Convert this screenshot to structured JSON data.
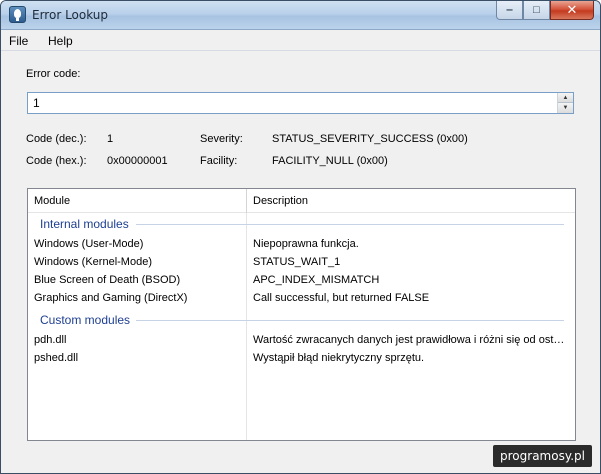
{
  "window": {
    "title": "Error Lookup"
  },
  "menu": [
    {
      "label": "File"
    },
    {
      "label": "Help"
    }
  ],
  "error_code": {
    "label": "Error code:",
    "value": "1"
  },
  "info": {
    "code_dec_label": "Code (dec.):",
    "code_dec_value": "1",
    "code_hex_label": "Code (hex.):",
    "code_hex_value": "0x00000001",
    "severity_label": "Severity:",
    "severity_value": "STATUS_SEVERITY_SUCCESS (0x00)",
    "facility_label": "Facility:",
    "facility_value": "FACILITY_NULL (0x00)"
  },
  "list": {
    "columns": [
      "Module",
      "Description"
    ],
    "groups": [
      {
        "name": "Internal modules",
        "rows": [
          {
            "module": "Windows (User-Mode)",
            "description": "Niepoprawna funkcja."
          },
          {
            "module": "Windows (Kernel-Mode)",
            "description": "STATUS_WAIT_1"
          },
          {
            "module": "Blue Screen of Death (BSOD)",
            "description": "APC_INDEX_MISMATCH"
          },
          {
            "module": "Graphics and Gaming (DirectX)",
            "description": "Call successful, but returned FALSE"
          }
        ]
      },
      {
        "name": "Custom modules",
        "rows": [
          {
            "module": "pdh.dll",
            "description": "Wartość zwracanych danych jest prawidłowa i różni się od ost…"
          },
          {
            "module": "pshed.dll",
            "description": "Wystąpił błąd niekrytyczny sprzętu."
          }
        ]
      }
    ]
  },
  "watermark": {
    "text": "programosy.pl"
  },
  "icons": {
    "app": "bug-icon",
    "minimize": "minimize-icon",
    "maximize": "maximize-icon",
    "close": "close-icon",
    "spin_up": "chevron-up-icon",
    "spin_down": "chevron-down-icon"
  }
}
